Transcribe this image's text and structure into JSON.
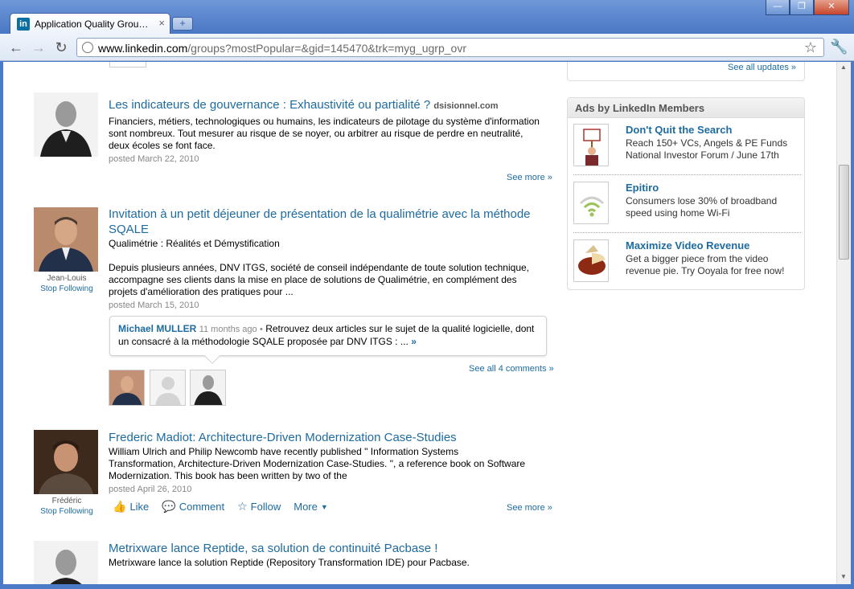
{
  "browser": {
    "tab_title": "Application Quality Grou…",
    "tab_favicon_text": "in",
    "tab_close": "×",
    "new_tab": "+",
    "url_domain": "www.linkedin.com",
    "url_path": "/groups?mostPopular=&gid=145470&trk=myg_ugrp_ovr",
    "minimize": "—",
    "maximize": "❐",
    "close": "✕",
    "back": "←",
    "forward": "→",
    "reload": "↻",
    "bookmark_star": "☆",
    "wrench": "🔧"
  },
  "sidebar": {
    "see_all_updates": "See all updates »",
    "ads_header": "Ads by LinkedIn Members",
    "ads": [
      {
        "title": "Don't Quit the Search",
        "text": "Reach 150+ VCs, Angels & PE Funds National Investor Forum / June 17th",
        "icon": "protest-sign-icon"
      },
      {
        "title": "Epitiro",
        "text": "Consumers lose 30% of broadband speed using home Wi-Fi",
        "icon": "wifi-icon"
      },
      {
        "title": "Maximize Video Revenue",
        "text": "Get a bigger piece from the video revenue pie. Try Ooyala for free now!",
        "icon": "pie-icon"
      }
    ]
  },
  "posts": [
    {
      "title": "Les indicateurs de gouvernance : Exhaustivité ou partialité ?",
      "source": "dsisionnel.com",
      "text": "Financiers, métiers, technologiques ou humains, les indicateurs de pilotage du système d'information sont nombreux. Tout mesurer au risque de se noyer, ou arbitrer au risque de perdre en neutralité, deux écoles se font face.",
      "date": "posted March 22, 2010",
      "see_more": "See more »"
    },
    {
      "title": "Invitation à un petit déjeuner de présentation de la qualimétrie avec la méthode SQALE",
      "subtitle": "Qualimétrie : Réalités et Démystification",
      "text": "Depuis plusieurs années, DNV ITGS, société de conseil indépendante de toute solution technique, accompagne ses clients dans la mise en place de solutions de Qualimétrie, en complément des projets d'amélioration des pratiques pour ...",
      "date": "posted March 15, 2010",
      "author": "Jean-Louis",
      "stop_following": "Stop Following",
      "comment": {
        "author": "Michael MULLER",
        "time": "11 months ago",
        "bullet": "•",
        "text": "Retrouvez deux articles sur le sujet de la qualité logicielle, dont un consacré à la méthodologie SQALE proposée par DNV ITGS : ...",
        "more": "»"
      },
      "see_all_comments": "See all 4 comments »"
    },
    {
      "title": "Frederic Madiot: Architecture-Driven Modernization Case-Studies",
      "text": "William Ulrich and Philip Newcomb have recently published \" Information Systems Transformation, Architecture-Driven Modernization Case-Studies. \", a reference book on Software Modernization. This book has been written by two of the",
      "date": "posted April 26, 2010",
      "author": "Frédéric",
      "stop_following": "Stop Following",
      "actions": {
        "like": "Like",
        "comment": "Comment",
        "follow": "Follow",
        "more": "More"
      },
      "see_more": "See more »"
    },
    {
      "title": "Metrixware lance Reptide, sa solution de continuité Pacbase !",
      "text": "Metrixware lance la solution Reptide (Repository Transformation IDE) pour Pacbase."
    }
  ]
}
